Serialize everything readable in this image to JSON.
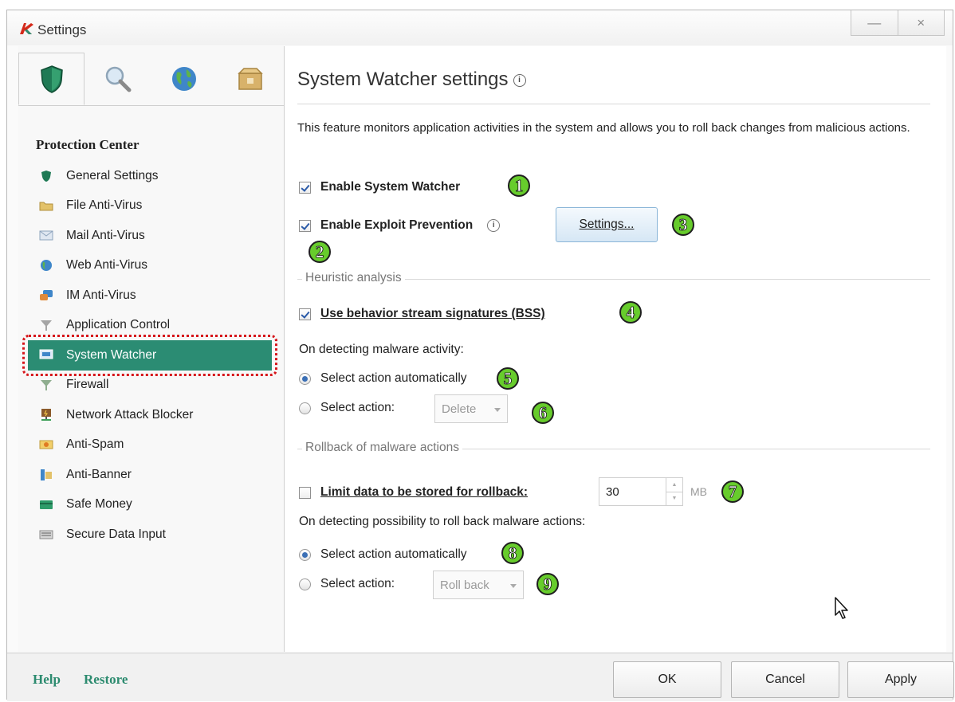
{
  "window": {
    "title": "Settings",
    "minimize": "—",
    "close": "×"
  },
  "sidebar": {
    "tabs": [
      {
        "icon": "shield-icon",
        "active": true
      },
      {
        "icon": "magnifier-icon",
        "active": false
      },
      {
        "icon": "globe-icon",
        "active": false
      },
      {
        "icon": "box-icon",
        "active": false
      }
    ],
    "section_title": "Protection Center",
    "items": [
      {
        "label": "General Settings",
        "icon": "shield-icon"
      },
      {
        "label": "File Anti-Virus",
        "icon": "folder-icon"
      },
      {
        "label": "Mail Anti-Virus",
        "icon": "envelope-icon"
      },
      {
        "label": "Web Anti-Virus",
        "icon": "globe-icon"
      },
      {
        "label": "IM Anti-Virus",
        "icon": "chat-icon"
      },
      {
        "label": "Application Control",
        "icon": "filter-icon"
      },
      {
        "label": "System Watcher",
        "icon": "monitor-icon",
        "selected": true
      },
      {
        "label": "Firewall",
        "icon": "filter-icon"
      },
      {
        "label": "Network Attack Blocker",
        "icon": "network-icon"
      },
      {
        "label": "Anti-Spam",
        "icon": "warning-envelope-icon"
      },
      {
        "label": "Anti-Banner",
        "icon": "banner-icon"
      },
      {
        "label": "Safe Money",
        "icon": "card-icon"
      },
      {
        "label": "Secure Data Input",
        "icon": "keyboard-icon"
      }
    ]
  },
  "main": {
    "heading": "System Watcher settings",
    "info_glyph": "i",
    "description": "This feature monitors application activities in the system and allows you to roll back changes from malicious actions.",
    "enable_system_watcher": {
      "label": "Enable System Watcher",
      "checked": true
    },
    "enable_exploit_prevention": {
      "label": "Enable Exploit Prevention",
      "checked": true
    },
    "settings_button": "Settings...",
    "heuristic_group": "Heuristic analysis",
    "use_bss": {
      "label": "Use behavior stream signatures (BSS)",
      "checked": true
    },
    "on_detecting_malware": "On detecting malware activity:",
    "malware_auto": "Select action automatically",
    "malware_select_action": "Select action:",
    "malware_action_value": "Delete",
    "rollback_group": "Rollback of malware actions",
    "limit_data": {
      "label": "Limit data to be stored for rollback:",
      "checked": false
    },
    "limit_value": "30",
    "limit_unit": "MB",
    "on_detecting_rollback": "On detecting possibility to roll back malware actions:",
    "rollback_auto": "Select action automatically",
    "rollback_select_action": "Select action:",
    "rollback_action_value": "Roll back"
  },
  "badges": [
    "1",
    "2",
    "3",
    "4",
    "5",
    "6",
    "7",
    "8",
    "9"
  ],
  "footer": {
    "help": "Help",
    "restore": "Restore",
    "ok": "OK",
    "cancel": "Cancel",
    "apply": "Apply"
  },
  "colors": {
    "accent": "#2b8c73",
    "badge": "#67cc2c",
    "highlight_outline": "#d6161b"
  }
}
